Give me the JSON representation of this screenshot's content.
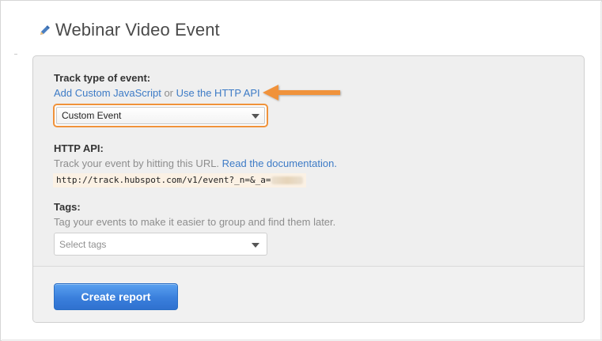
{
  "page": {
    "title": "Webinar Video Event"
  },
  "track": {
    "label": "Track type of event:",
    "link_js": "Add Custom JavaScript",
    "or_text": " or ",
    "link_api": "Use the HTTP API",
    "select_value": "Custom Event"
  },
  "http_api": {
    "label": "HTTP API:",
    "help_text": "Track your event by hitting this URL. ",
    "doc_link": "Read the documentation.",
    "url": "http://track.hubspot.com/v1/event?_n=&_a="
  },
  "tags": {
    "label": "Tags:",
    "help_text": "Tag your events to make it easier to group and find them later.",
    "placeholder": "Select tags"
  },
  "footer": {
    "create_label": "Create report"
  },
  "colors": {
    "accent_orange": "#f0923a",
    "link_blue": "#3d7bc6",
    "button_blue": "#3a7fdc"
  },
  "icons": {
    "title_icon": "pencil-icon",
    "dropdown": "chevron-down-icon",
    "callout": "arrow-left-icon"
  }
}
